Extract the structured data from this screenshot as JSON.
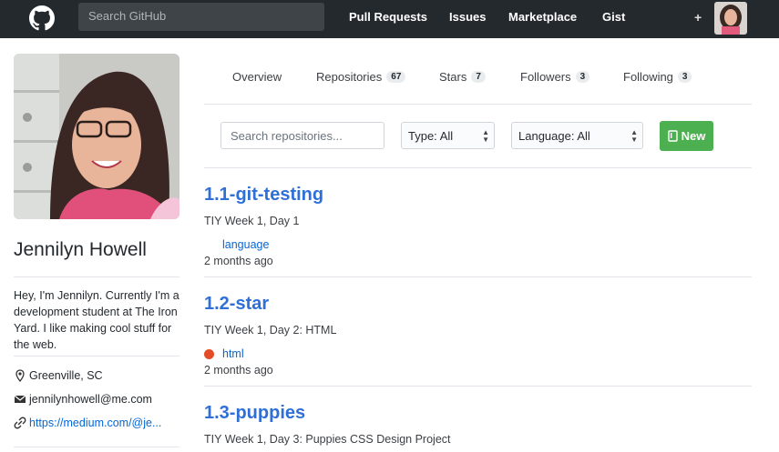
{
  "header": {
    "search_placeholder": "Search GitHub",
    "nav": [
      "Pull Requests",
      "Issues",
      "Marketplace",
      "Gist"
    ],
    "plus": "+"
  },
  "profile": {
    "name": "Jennilyn Howell",
    "bio": "Hey, I'm Jennilyn. Currently I'm a development student at The Iron Yard. I like making cool stuff for the web.",
    "location": "Greenville, SC",
    "email": "jennilynhowell@me.com",
    "website": "https://medium.com/@je..."
  },
  "tabs": [
    {
      "label": "Overview",
      "count": null
    },
    {
      "label": "Repositories",
      "count": "67"
    },
    {
      "label": "Stars",
      "count": "7"
    },
    {
      "label": "Followers",
      "count": "3"
    },
    {
      "label": "Following",
      "count": "3"
    }
  ],
  "filters": {
    "search_placeholder": "Search repositories...",
    "type": "Type: All",
    "language": "Language: All",
    "new_label": "New"
  },
  "repos": [
    {
      "name": "1.1-git-testing",
      "description": "TIY Week 1, Day 1",
      "language": "language",
      "updated": "2 months ago"
    },
    {
      "name": "1.2-star",
      "description": "TIY Week 1, Day 2: HTML",
      "language": "html",
      "updated": "2 months ago"
    },
    {
      "name": "1.3-puppies",
      "description": "TIY Week 1, Day 3: Puppies CSS Design Project"
    }
  ],
  "colors": {
    "html_dot": "#e34c26",
    "new_button": "#4caf50",
    "link": "#2f6fd6"
  }
}
